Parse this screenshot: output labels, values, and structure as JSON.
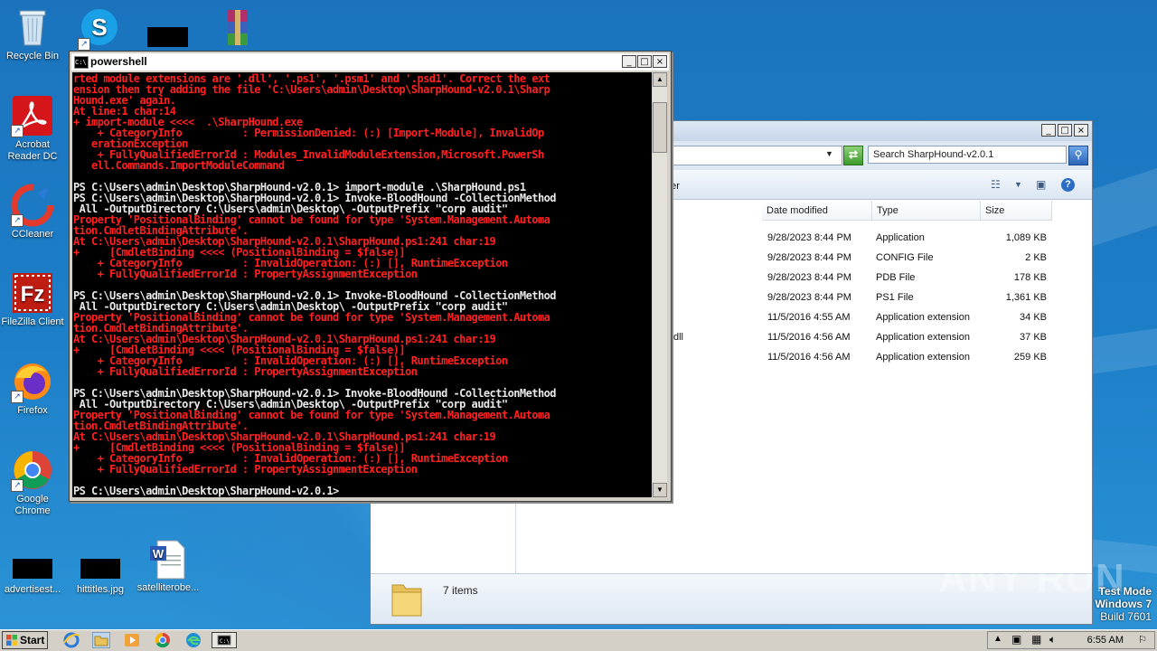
{
  "desktop": {
    "icons": [
      {
        "label": "Recycle Bin"
      },
      {
        "label": "Acrobat Reader DC"
      },
      {
        "label": "CCleaner"
      },
      {
        "label": "FileZilla Client"
      },
      {
        "label": "Firefox"
      },
      {
        "label": "Google Chrome"
      },
      {
        "label": "advertisest..."
      },
      {
        "label": "hittitles.jpg"
      },
      {
        "label": "satelliterobe..."
      }
    ]
  },
  "explorer": {
    "search_placeholder": "Search SharpHound-v2.0.1",
    "toolbar_partial": "der",
    "columns": [
      "Date modified",
      "Type",
      "Size"
    ],
    "rows": [
      {
        "name": "",
        "date": "9/28/2023 8:44 PM",
        "type": "Application",
        "size": "1,089 KB"
      },
      {
        "name": "",
        "date": "9/28/2023 8:44 PM",
        "type": "CONFIG File",
        "size": "2 KB"
      },
      {
        "name": "",
        "date": "9/28/2023 8:44 PM",
        "type": "PDB File",
        "size": "178 KB"
      },
      {
        "name": "",
        "date": "9/28/2023 8:44 PM",
        "type": "PS1 File",
        "size": "1,361 KB"
      },
      {
        "name": "",
        "date": "11/5/2016 4:55 AM",
        "type": "Application extension",
        "size": "34 KB"
      },
      {
        "name": "dll",
        "date": "11/5/2016 4:56 AM",
        "type": "Application extension",
        "size": "37 KB"
      },
      {
        "name": "",
        "date": "11/5/2016 4:56 AM",
        "type": "Application extension",
        "size": "259 KB"
      }
    ],
    "status": "7 items"
  },
  "powershell": {
    "title": "powershell",
    "lines": [
      {
        "c": "e",
        "t": "rted module extensions are '.dll', '.ps1', '.psm1' and '.psd1'. Correct the ext"
      },
      {
        "c": "e",
        "t": "ension then try adding the file 'C:\\Users\\admin\\Desktop\\SharpHound-v2.0.1\\Sharp"
      },
      {
        "c": "e",
        "t": "Hound.exe' again."
      },
      {
        "c": "e",
        "t": "At line:1 char:14"
      },
      {
        "c": "e",
        "t": "+ import-module <<<<  .\\SharpHound.exe"
      },
      {
        "c": "e",
        "t": "    + CategoryInfo          : PermissionDenied: (:) [Import-Module], InvalidOp"
      },
      {
        "c": "e",
        "t": "   erationException"
      },
      {
        "c": "e",
        "t": "    + FullyQualifiedErrorId : Modules_InvalidModuleExtension,Microsoft.PowerSh"
      },
      {
        "c": "e",
        "t": "   ell.Commands.ImportModuleCommand"
      },
      {
        "c": "w",
        "t": ""
      },
      {
        "c": "w",
        "t": "PS C:\\Users\\admin\\Desktop\\SharpHound-v2.0.1> import-module .\\SharpHound.ps1"
      },
      {
        "c": "w",
        "t": "PS C:\\Users\\admin\\Desktop\\SharpHound-v2.0.1> Invoke-BloodHound -CollectionMethod"
      },
      {
        "c": "w",
        "t": " All -OutputDirectory C:\\Users\\admin\\Desktop\\ -OutputPrefix \"corp audit\""
      },
      {
        "c": "e",
        "t": "Property 'PositionalBinding' cannot be found for type 'System.Management.Automa"
      },
      {
        "c": "e",
        "t": "tion.CmdletBindingAttribute'."
      },
      {
        "c": "e",
        "t": "At C:\\Users\\admin\\Desktop\\SharpHound-v2.0.1\\SharpHound.ps1:241 char:19"
      },
      {
        "c": "e",
        "t": "+     [CmdletBinding <<<< (PositionalBinding = $false)]"
      },
      {
        "c": "e",
        "t": "    + CategoryInfo          : InvalidOperation: (:) [], RuntimeException"
      },
      {
        "c": "e",
        "t": "    + FullyQualifiedErrorId : PropertyAssignmentException"
      },
      {
        "c": "w",
        "t": ""
      },
      {
        "c": "w",
        "t": "PS C:\\Users\\admin\\Desktop\\SharpHound-v2.0.1> Invoke-BloodHound -CollectionMethod"
      },
      {
        "c": "w",
        "t": " All -OutputDirectory C:\\Users\\admin\\Desktop\\ -OutputPrefix \"corp audit\""
      },
      {
        "c": "e",
        "t": "Property 'PositionalBinding' cannot be found for type 'System.Management.Automa"
      },
      {
        "c": "e",
        "t": "tion.CmdletBindingAttribute'."
      },
      {
        "c": "e",
        "t": "At C:\\Users\\admin\\Desktop\\SharpHound-v2.0.1\\SharpHound.ps1:241 char:19"
      },
      {
        "c": "e",
        "t": "+     [CmdletBinding <<<< (PositionalBinding = $false)]"
      },
      {
        "c": "e",
        "t": "    + CategoryInfo          : InvalidOperation: (:) [], RuntimeException"
      },
      {
        "c": "e",
        "t": "    + FullyQualifiedErrorId : PropertyAssignmentException"
      },
      {
        "c": "w",
        "t": ""
      },
      {
        "c": "w",
        "t": "PS C:\\Users\\admin\\Desktop\\SharpHound-v2.0.1> Invoke-BloodHound -CollectionMethod"
      },
      {
        "c": "w",
        "t": " All -OutputDirectory C:\\Users\\admin\\Desktop\\ -OutputPrefix \"corp audit\""
      },
      {
        "c": "e",
        "t": "Property 'PositionalBinding' cannot be found for type 'System.Management.Automa"
      },
      {
        "c": "e",
        "t": "tion.CmdletBindingAttribute'."
      },
      {
        "c": "e",
        "t": "At C:\\Users\\admin\\Desktop\\SharpHound-v2.0.1\\SharpHound.ps1:241 char:19"
      },
      {
        "c": "e",
        "t": "+     [CmdletBinding <<<< (PositionalBinding = $false)]"
      },
      {
        "c": "e",
        "t": "    + CategoryInfo          : InvalidOperation: (:) [], RuntimeException"
      },
      {
        "c": "e",
        "t": "    + FullyQualifiedErrorId : PropertyAssignmentException"
      },
      {
        "c": "w",
        "t": ""
      },
      {
        "c": "w",
        "t": "PS C:\\Users\\admin\\Desktop\\SharpHound-v2.0.1>"
      }
    ]
  },
  "watermark": {
    "text": "ANY RUN"
  },
  "test_mode": {
    "line1": "Test Mode",
    "line2": "Windows 7",
    "line3": "Build 7601"
  },
  "taskbar": {
    "start_label": "Start",
    "clock": "6:55 AM"
  },
  "colors": {
    "console_error": "#ff2020",
    "console_text": "#e8e8e8",
    "console_bg": "#000000",
    "desktop_blue": "#1d7fc8"
  }
}
